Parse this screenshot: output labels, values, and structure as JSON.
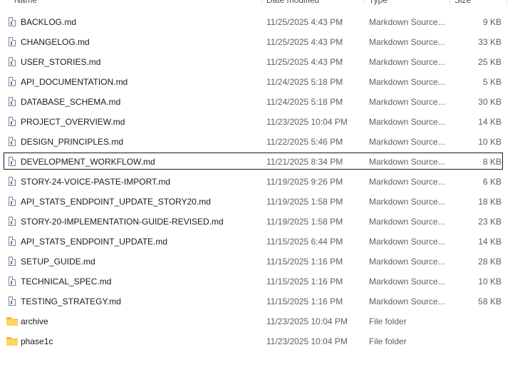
{
  "columns": {
    "name": "Name",
    "date_modified": "Date modified",
    "type": "Type",
    "size": "Size"
  },
  "selected_index": 7,
  "files": [
    {
      "icon": "markdown-file-icon",
      "name": "BACKLOG.md",
      "date": "11/25/2025 4:43 PM",
      "type": "Markdown Source...",
      "size": "9 KB"
    },
    {
      "icon": "markdown-file-icon",
      "name": "CHANGELOG.md",
      "date": "11/25/2025 4:43 PM",
      "type": "Markdown Source...",
      "size": "33 KB"
    },
    {
      "icon": "markdown-file-icon",
      "name": "USER_STORIES.md",
      "date": "11/25/2025 4:43 PM",
      "type": "Markdown Source...",
      "size": "25 KB"
    },
    {
      "icon": "markdown-file-icon",
      "name": "API_DOCUMENTATION.md",
      "date": "11/24/2025 5:18 PM",
      "type": "Markdown Source...",
      "size": "5 KB"
    },
    {
      "icon": "markdown-file-icon",
      "name": "DATABASE_SCHEMA.md",
      "date": "11/24/2025 5:18 PM",
      "type": "Markdown Source...",
      "size": "30 KB"
    },
    {
      "icon": "markdown-file-icon",
      "name": "PROJECT_OVERVIEW.md",
      "date": "11/23/2025 10:04 PM",
      "type": "Markdown Source...",
      "size": "14 KB"
    },
    {
      "icon": "markdown-file-icon",
      "name": "DESIGN_PRINCIPLES.md",
      "date": "11/22/2025 5:46 PM",
      "type": "Markdown Source...",
      "size": "10 KB"
    },
    {
      "icon": "markdown-file-icon",
      "name": "DEVELOPMENT_WORKFLOW.md",
      "date": "11/21/2025 8:34 PM",
      "type": "Markdown Source...",
      "size": "8 KB"
    },
    {
      "icon": "markdown-file-icon",
      "name": "STORY-24-VOICE-PASTE-IMPORT.md",
      "date": "11/19/2025 9:26 PM",
      "type": "Markdown Source...",
      "size": "6 KB"
    },
    {
      "icon": "markdown-file-icon",
      "name": "API_STATS_ENDPOINT_UPDATE_STORY20.md",
      "date": "11/19/2025 1:58 PM",
      "type": "Markdown Source...",
      "size": "18 KB"
    },
    {
      "icon": "markdown-file-icon",
      "name": "STORY-20-IMPLEMENTATION-GUIDE-REVISED.md",
      "date": "11/19/2025 1:58 PM",
      "type": "Markdown Source...",
      "size": "23 KB"
    },
    {
      "icon": "markdown-file-icon",
      "name": "API_STATS_ENDPOINT_UPDATE.md",
      "date": "11/15/2025 6:44 PM",
      "type": "Markdown Source...",
      "size": "14 KB"
    },
    {
      "icon": "markdown-file-icon",
      "name": "SETUP_GUIDE.md",
      "date": "11/15/2025 1:16 PM",
      "type": "Markdown Source...",
      "size": "28 KB"
    },
    {
      "icon": "markdown-file-icon",
      "name": "TECHNICAL_SPEC.md",
      "date": "11/15/2025 1:16 PM",
      "type": "Markdown Source...",
      "size": "10 KB"
    },
    {
      "icon": "markdown-file-icon",
      "name": "TESTING_STRATEGY.md",
      "date": "11/15/2025 1:16 PM",
      "type": "Markdown Source...",
      "size": "58 KB"
    },
    {
      "icon": "folder-icon",
      "name": "archive",
      "date": "11/23/2025 10:04 PM",
      "type": "File folder",
      "size": ""
    },
    {
      "icon": "folder-icon",
      "name": "phase1c",
      "date": "11/23/2025 10:04 PM",
      "type": "File folder",
      "size": ""
    }
  ]
}
